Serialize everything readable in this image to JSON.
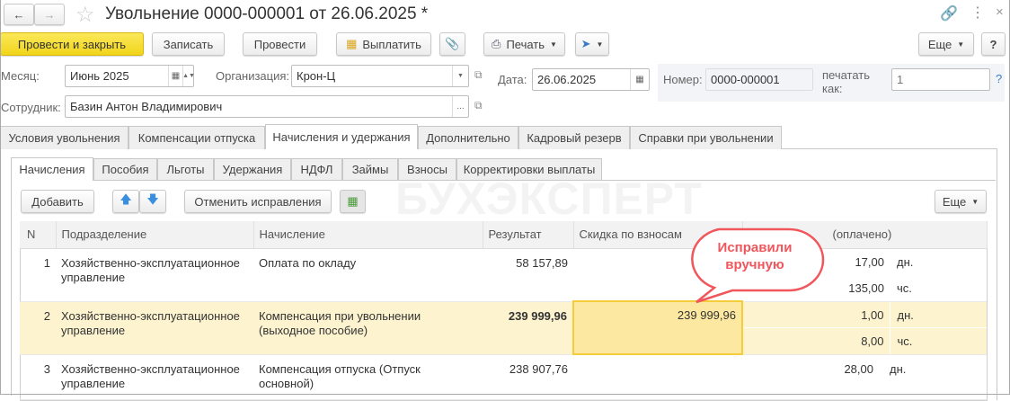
{
  "window": {
    "title": "Увольнение 0000-000001 от 26.06.2025 *"
  },
  "toolbar": {
    "post_close": "Провести и закрыть",
    "save": "Записать",
    "post": "Провести",
    "pay": "Выплатить",
    "print": "Печать",
    "more": "Еще",
    "help": "?"
  },
  "header": {
    "month_label": "Месяц:",
    "month_value": "Июнь 2025",
    "org_label": "Организация:",
    "org_value": "Крон-Ц",
    "date_label": "Дата:",
    "date_value": "26.06.2025",
    "number_label": "Номер:",
    "number_value": "0000-000001",
    "print_as_label": "печатать как:",
    "print_as_placeholder": "1",
    "help": "?",
    "employee_label": "Сотрудник:",
    "employee_value": "Базин Антон Владимирович"
  },
  "tabs": [
    "Условия увольнения",
    "Компенсации отпуска",
    "Начисления и удержания",
    "Дополнительно",
    "Кадровый резерв",
    "Справки при увольнении"
  ],
  "subtabs": [
    "Начисления",
    "Пособия",
    "Льготы",
    "Удержания",
    "НДФЛ",
    "Займы",
    "Взносы",
    "Корректировки выплаты"
  ],
  "table_toolbar": {
    "add": "Добавить",
    "cancel_fix": "Отменить исправления",
    "more": "Еще"
  },
  "watermark": "БУХЭКСПЕРТ",
  "table": {
    "columns": [
      "N",
      "Подразделение",
      "Начисление",
      "Результат",
      "Скидка по взносам",
      "(оплачено)"
    ],
    "rows": [
      {
        "n": "1",
        "dept": "Хозяйственно-эксплуатационное управление",
        "accrual": "Оплата по окладу",
        "result": "58 157,89",
        "discount": "",
        "days": "17,00",
        "days_unit": "дн.",
        "hours": "135,00",
        "hours_unit": "чс."
      },
      {
        "n": "2",
        "dept": "Хозяйственно-эксплуатационное управление",
        "accrual": "Компенсация при увольнении (выходное пособие)",
        "result": "239 999,96",
        "discount": "239 999,96",
        "days": "1,00",
        "days_unit": "дн.",
        "hours": "8,00",
        "hours_unit": "чс."
      },
      {
        "n": "3",
        "dept": "Хозяйственно-эксплуатационное управление",
        "accrual": "Компенсация отпуска (Отпуск основной)",
        "result": "238 907,76",
        "discount": "",
        "days": "28,00",
        "days_unit": "дн."
      }
    ]
  },
  "callout": {
    "text": "Исправили вручную",
    "color": "#f0565b"
  }
}
